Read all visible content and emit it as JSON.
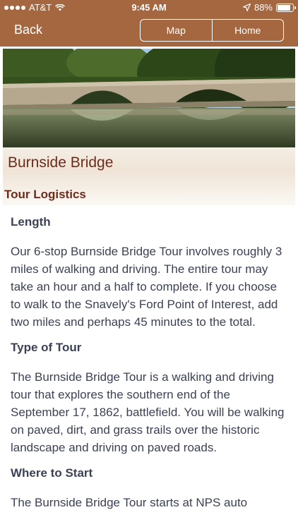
{
  "status": {
    "carrier": "AT&T",
    "time": "9:45 AM",
    "battery": "88%",
    "battery_level": 0.88
  },
  "nav": {
    "back_label": "Back",
    "segments": [
      "Map",
      "Home"
    ]
  },
  "hero": {
    "title": "Burnside Bridge",
    "section": "Tour Logistics"
  },
  "content": {
    "sections": [
      {
        "heading": "Length",
        "body": "Our 6-stop Burnside Bridge Tour involves roughly 3 miles of walking and driving. The entire tour may take an hour and a half to complete. If you choose to walk to the Snavely's Ford Point of Interest, add two miles and perhaps 45 minutes to the total."
      },
      {
        "heading": "Type of Tour",
        "body": "The Burnside Bridge Tour is a walking and driving tour that explores the southern end of the September 17, 1862, battlefield. You will be walking on paved, dirt, and grass trails over the historic landscape and driving on paved roads."
      },
      {
        "heading": "Where to Start",
        "body": "The Burnside Bridge Tour starts at NPS auto"
      }
    ]
  },
  "colors": {
    "bar": "#a4673f",
    "title": "#6b2c1c",
    "text": "#3b4254"
  },
  "icons": {
    "wifi": "wifi-icon",
    "location": "location-arrow-icon",
    "battery": "battery-icon"
  }
}
